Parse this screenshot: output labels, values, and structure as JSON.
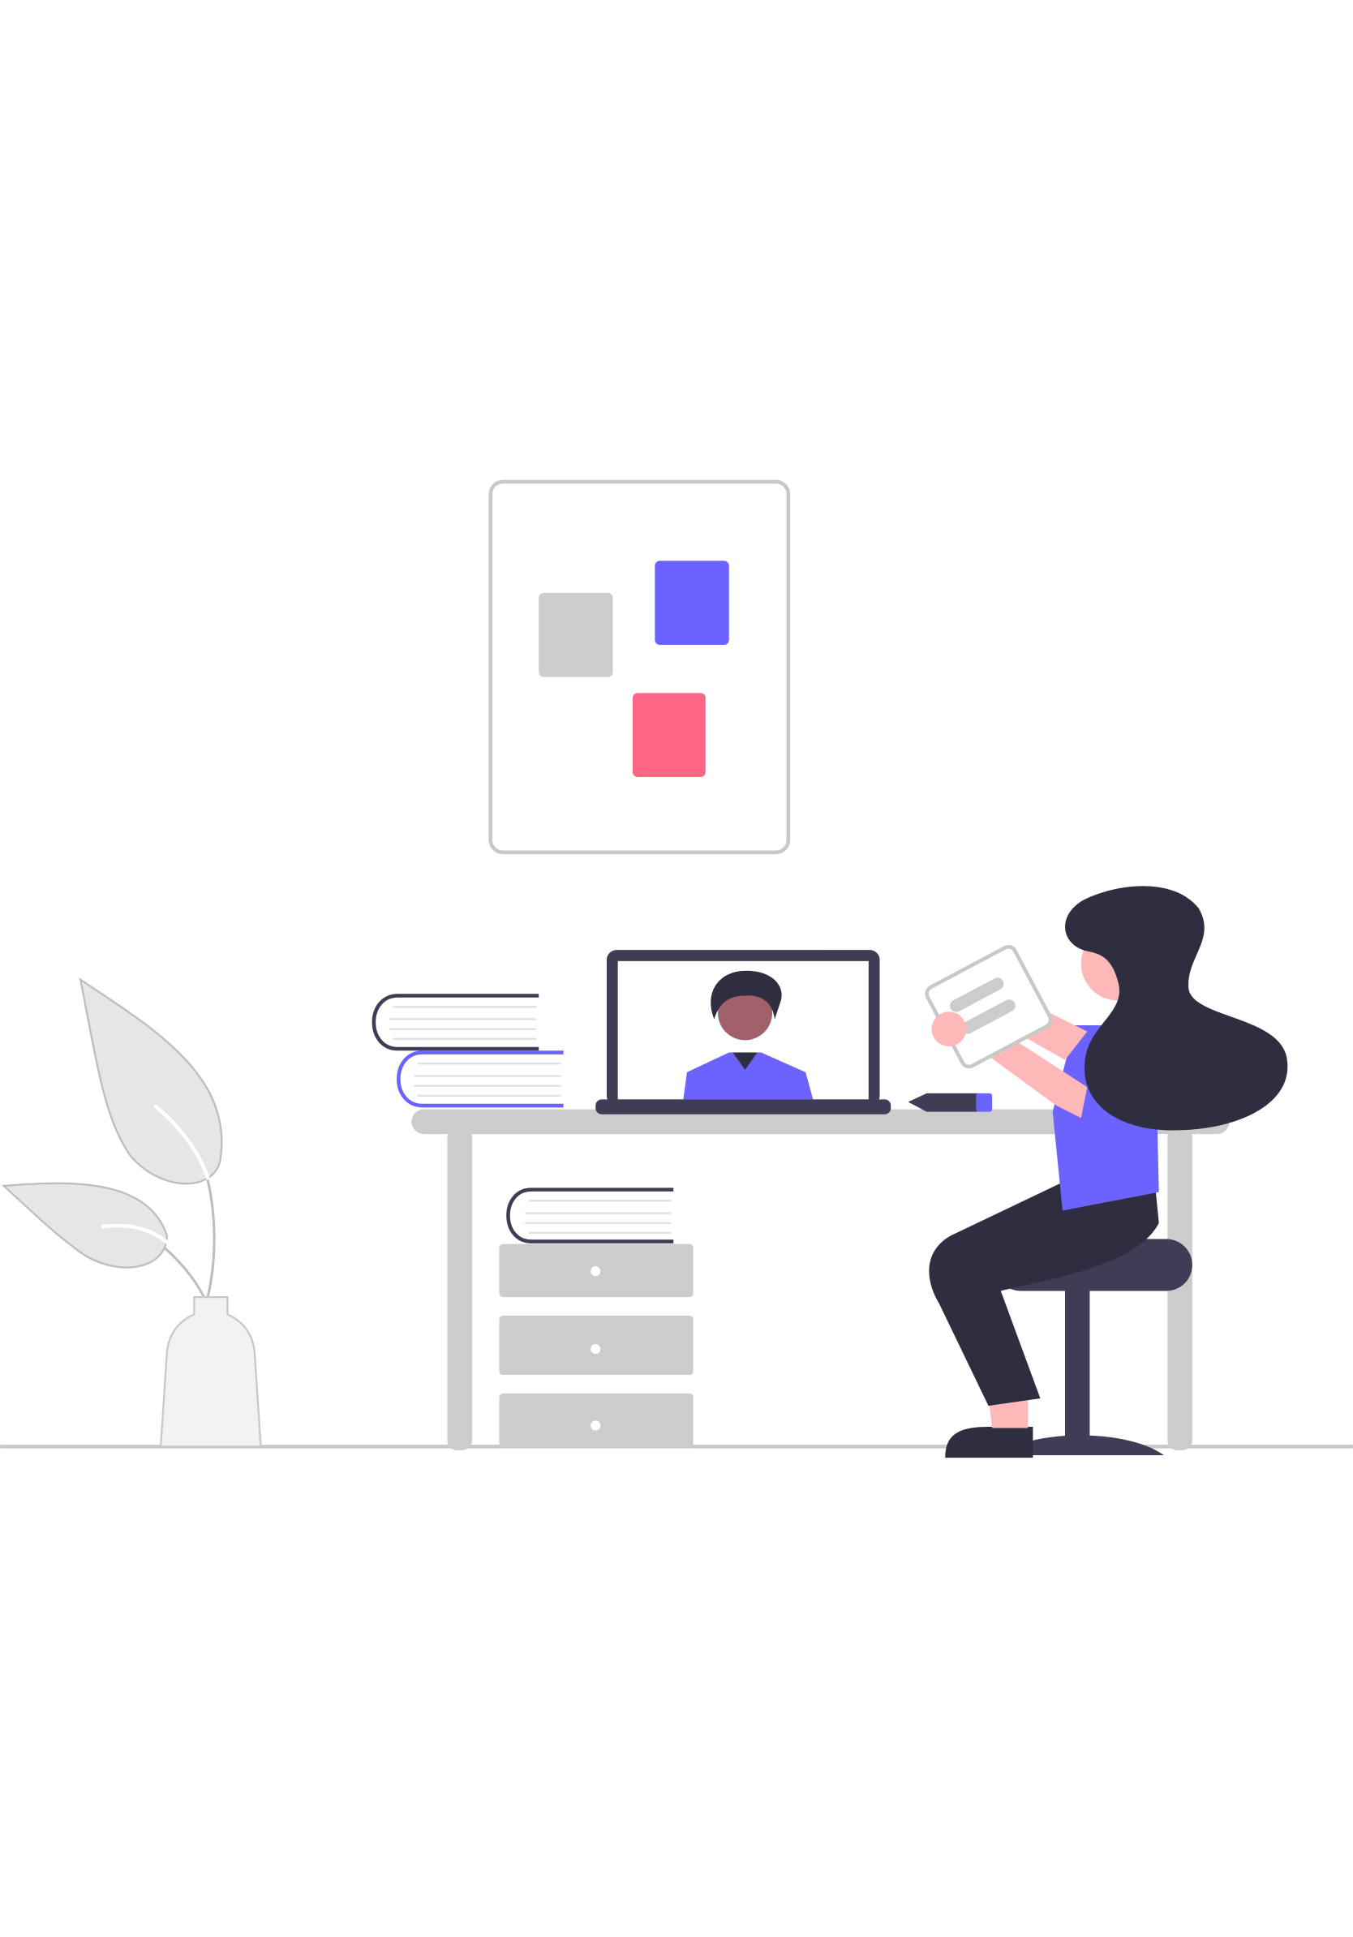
{
  "illustration": {
    "subject": "workspace-scene",
    "colors": {
      "background": "#ffffff",
      "light_gray": "#cccccc",
      "lighter_gray": "#e6e6e6",
      "vase": "#f2f2f2",
      "accent_purple": "#6c63ff",
      "accent_pink": "#ff6584",
      "dark": "#3f3d56",
      "darker": "#2f2e41",
      "skin_light": "#ffb8b8",
      "skin_dark": "#a0616a"
    }
  }
}
